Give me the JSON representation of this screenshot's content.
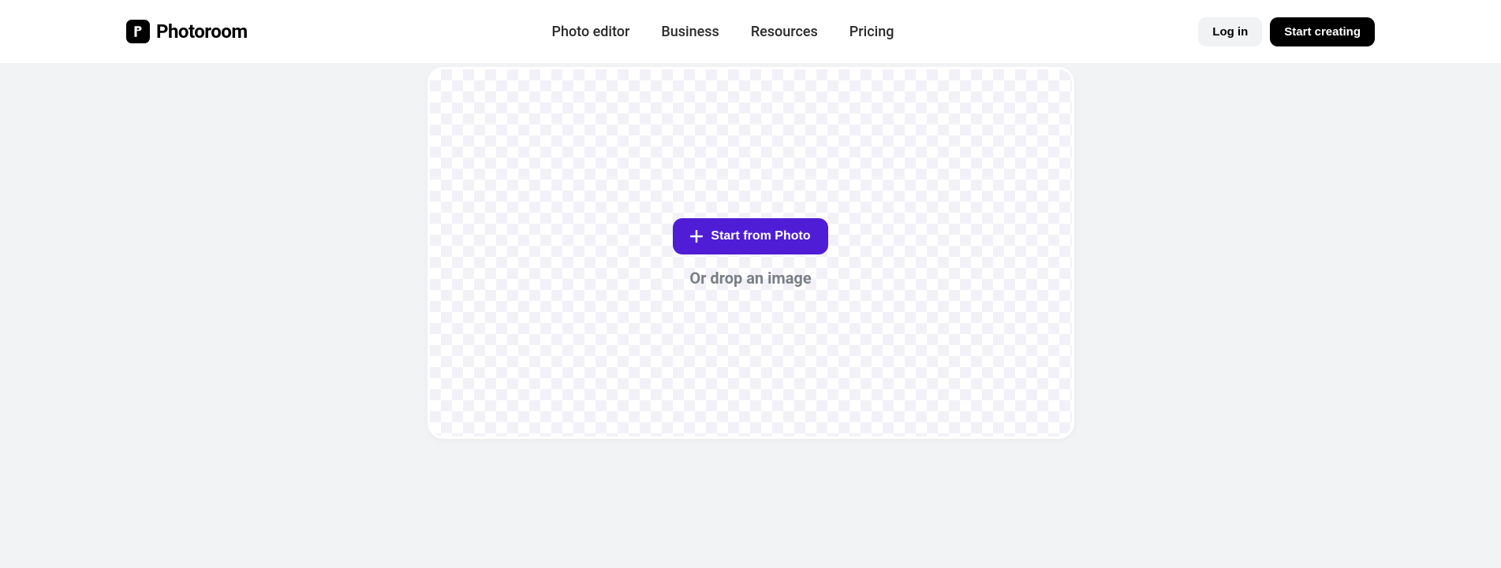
{
  "brand": {
    "name": "Photoroom"
  },
  "nav": {
    "items": [
      {
        "label": "Photo editor"
      },
      {
        "label": "Business"
      },
      {
        "label": "Resources"
      },
      {
        "label": "Pricing"
      }
    ]
  },
  "header": {
    "login_label": "Log in",
    "cta_label": "Start creating"
  },
  "upload": {
    "button_label": "Start from Photo",
    "drop_label": "Or drop an image"
  }
}
